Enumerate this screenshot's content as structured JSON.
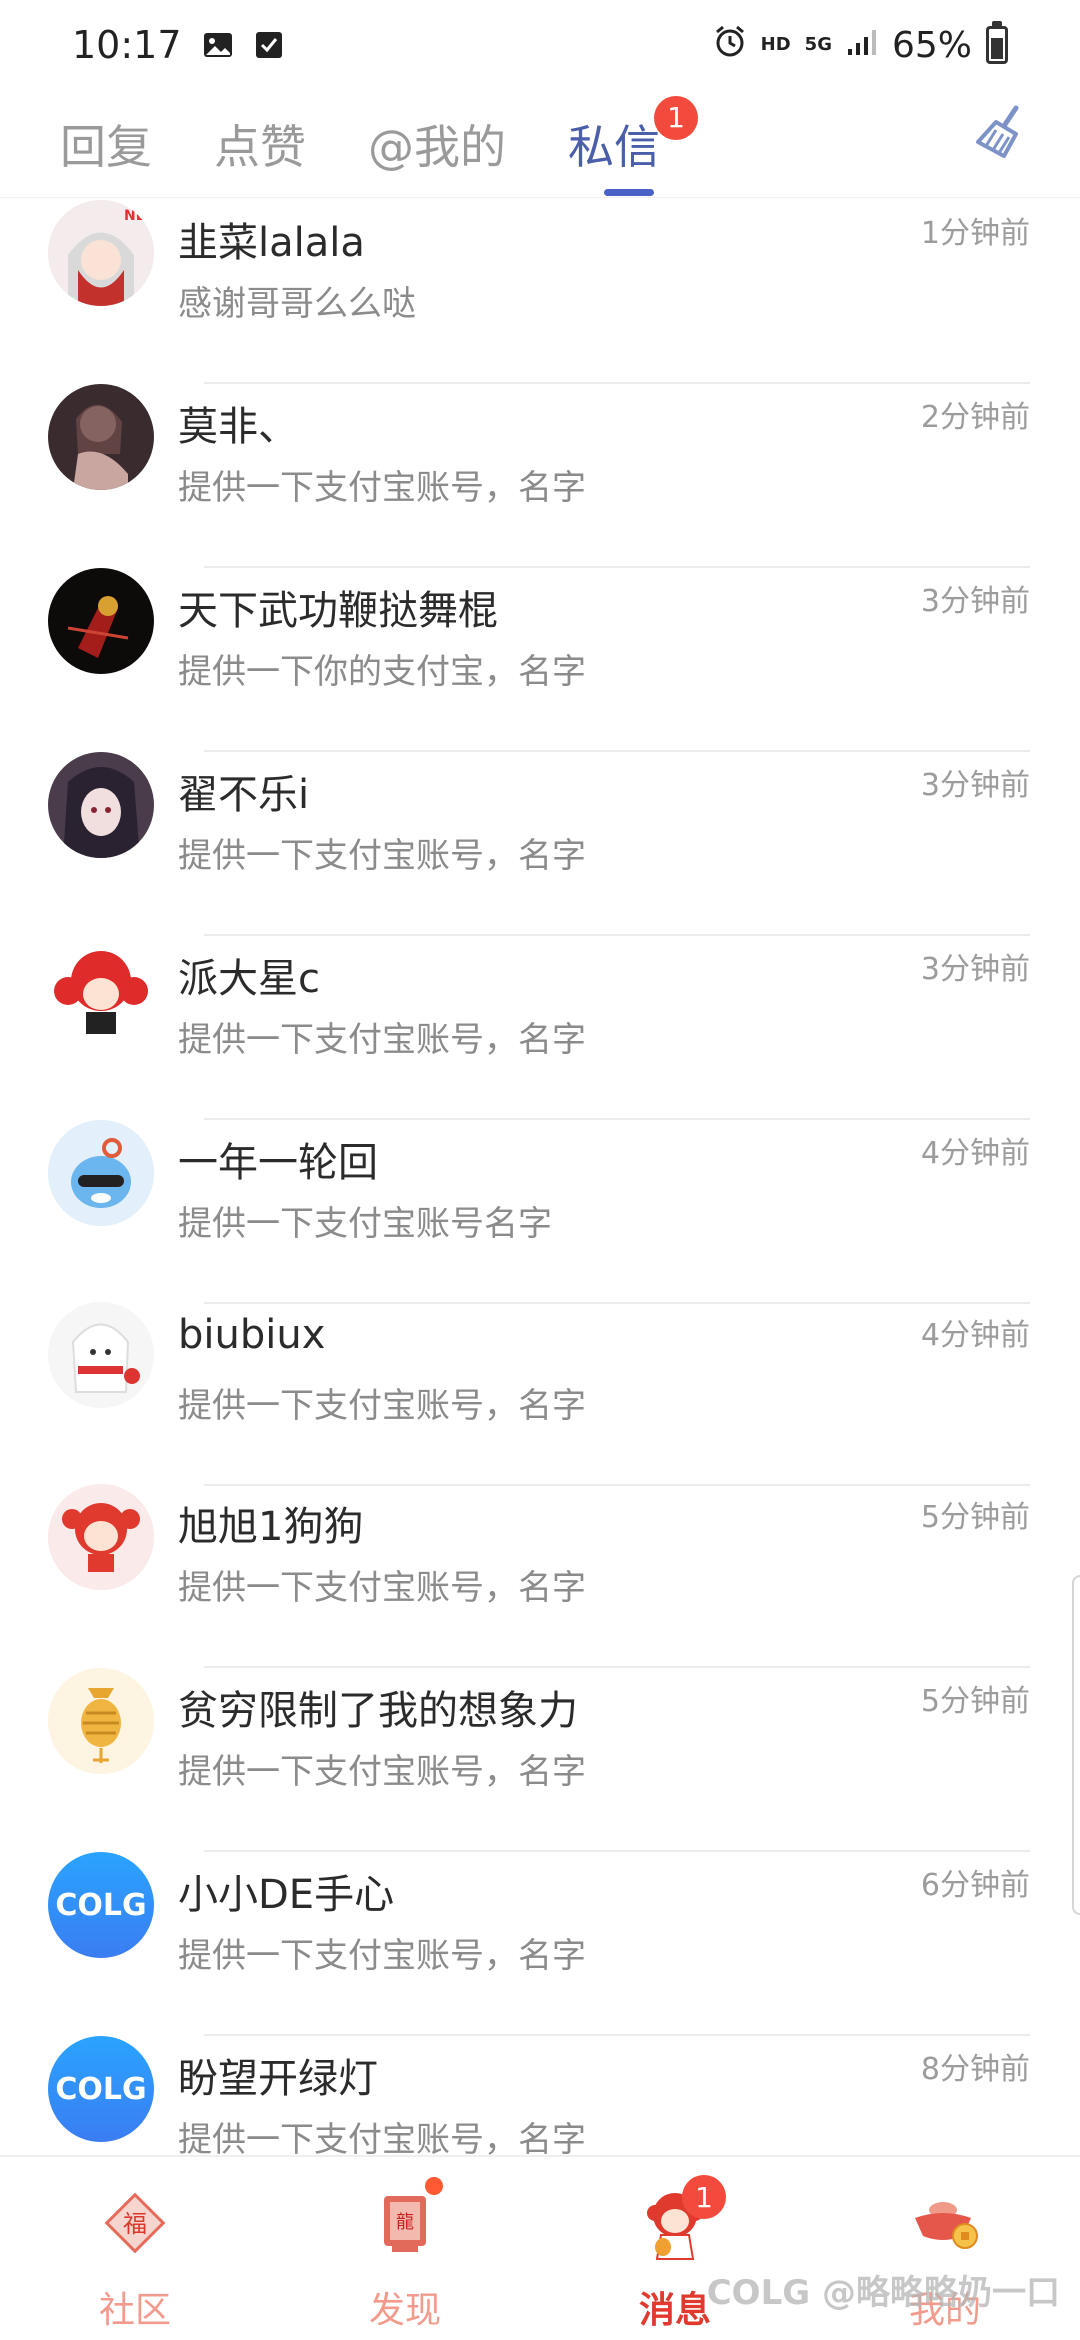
{
  "status_bar": {
    "time": "10:17",
    "network": "HD",
    "signal_type": "5G",
    "battery": "65%",
    "battery_level": 0.65
  },
  "top_tabs": [
    {
      "label": "回复",
      "active": false
    },
    {
      "label": "点赞",
      "active": false
    },
    {
      "label": "@我的",
      "active": false
    },
    {
      "label": "私信",
      "active": true,
      "badge": "1"
    }
  ],
  "messages": [
    {
      "name": "韭菜lalala",
      "preview": "感谢哥哥么么哒",
      "time": "1分钟前",
      "avatar": "anime-character-avatar"
    },
    {
      "name": "莫非、",
      "preview": "提供一下支付宝账号，名字",
      "time": "2分钟前",
      "avatar": "anime-character-avatar"
    },
    {
      "name": "天下武功鞭挞舞棍",
      "preview": "提供一下你的支付宝，名字",
      "time": "3分钟前",
      "avatar": "anime-character-avatar"
    },
    {
      "name": "翟不乐i",
      "preview": "提供一下支付宝账号，名字",
      "time": "3分钟前",
      "avatar": "anime-character-avatar"
    },
    {
      "name": "派大星c",
      "preview": "提供一下支付宝账号，名字",
      "time": "3分钟前",
      "avatar": "anime-character-avatar"
    },
    {
      "name": "一年一轮回",
      "preview": "提供一下支付宝账号名字",
      "time": "4分钟前",
      "avatar": "sunglasses-character-avatar"
    },
    {
      "name": "biubiux",
      "preview": "提供一下支付宝账号，名字",
      "time": "4分钟前",
      "avatar": "anime-character-avatar"
    },
    {
      "name": "旭旭1狗狗",
      "preview": "提供一下支付宝账号，名字",
      "time": "5分钟前",
      "avatar": "anime-character-avatar"
    },
    {
      "name": "贫穷限制了我的想象力",
      "preview": "提供一下支付宝账号，名字",
      "time": "5分钟前",
      "avatar": "lantern-avatar"
    },
    {
      "name": "小小DE手心",
      "preview": "提供一下支付宝账号，名字",
      "time": "6分钟前",
      "avatar": "colg-logo-avatar",
      "avatar_text": "COLG"
    },
    {
      "name": "盼望开绿灯",
      "preview": "提供一下支付宝账号，名字",
      "time": "8分钟前",
      "avatar": "colg-logo-avatar",
      "avatar_text": "COLG"
    }
  ],
  "bottom_nav": [
    {
      "label": "社区",
      "icon": "fortune-icon",
      "active": false
    },
    {
      "label": "发现",
      "icon": "dragon-banner-icon",
      "active": false,
      "dot": true
    },
    {
      "label": "消息",
      "icon": "message-character-icon",
      "active": true,
      "badge": "1"
    },
    {
      "label": "我的",
      "icon": "gold-ingot-icon",
      "active": false
    }
  ],
  "watermark": "COLG @略略略奶一口",
  "colors": {
    "active_tab": "#4a5ea9",
    "accent_red": "#e03a2f",
    "badge_red": "#f24b3d"
  }
}
